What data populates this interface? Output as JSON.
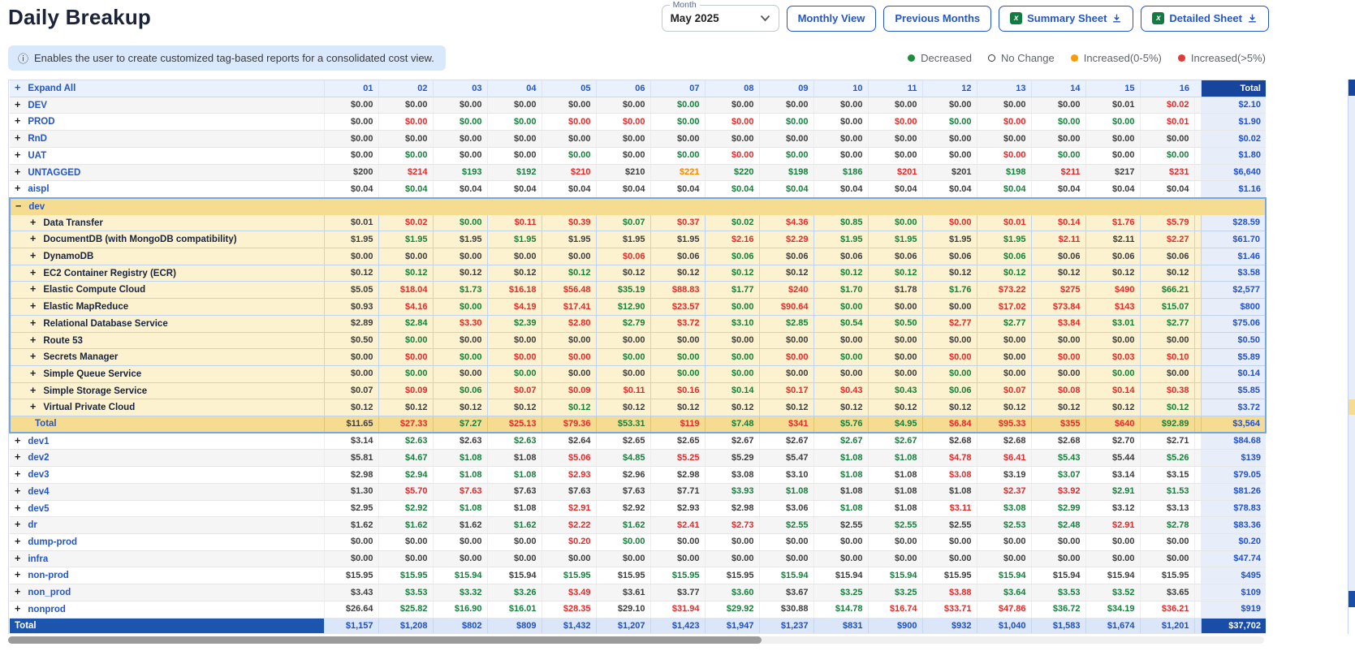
{
  "page": {
    "title": "Daily Breakup"
  },
  "toolbar": {
    "month_label": "Month",
    "month_value": "May 2025",
    "monthly_view": "Monthly View",
    "previous_months": "Previous Months",
    "summary_sheet": "Summary Sheet",
    "detailed_sheet": "Detailed Sheet",
    "excel_icon_color": "#107C41",
    "accent_color": "#2456c4"
  },
  "banner": {
    "text": "Enables the user to create customized tag-based reports for a consolidated cost view."
  },
  "legend": {
    "items": [
      {
        "label": "Decreased",
        "color": "#1e8e3e",
        "style": "filled"
      },
      {
        "label": "No Change",
        "color": "#333333",
        "style": "open"
      },
      {
        "label": "Increased(0-5%)",
        "color": "#f90",
        "style": "filled"
      },
      {
        "label": "Increased(>5%)",
        "color": "#e53935",
        "style": "filled"
      }
    ]
  },
  "table": {
    "expand_all": "Expand All",
    "total_header": "Total",
    "days": [
      "01",
      "02",
      "03",
      "04",
      "05",
      "06",
      "07",
      "08",
      "09",
      "10",
      "11",
      "12",
      "13",
      "14",
      "15",
      "16"
    ],
    "color_key": {
      "k": "no-change",
      "g": "decreased",
      "o": "increased-0-5",
      "r": "increased-gt5"
    },
    "rows": [
      {
        "label": "DEV",
        "type": "top",
        "shade": true,
        "expand": "plus",
        "values": [
          "$0.00",
          "$0.00",
          "$0.00",
          "$0.00",
          "$0.00",
          "$0.00",
          "$0.00",
          "$0.00",
          "$0.00",
          "$0.00",
          "$0.00",
          "$0.00",
          "$0.00",
          "$0.00",
          "$0.01",
          "$0.02"
        ],
        "colors": "kkkkkkgkkkkkkkkr",
        "total": "$2.10"
      },
      {
        "label": "PROD",
        "type": "top",
        "shade": false,
        "expand": "plus",
        "values": [
          "$0.00",
          "$0.00",
          "$0.00",
          "$0.00",
          "$0.00",
          "$0.00",
          "$0.00",
          "$0.00",
          "$0.00",
          "$0.00",
          "$0.00",
          "$0.00",
          "$0.00",
          "$0.00",
          "$0.00",
          "$0.01"
        ],
        "colors": "krggrrgrgkrgrggr",
        "total": "$1.90"
      },
      {
        "label": "RnD",
        "type": "top",
        "shade": true,
        "expand": "plus",
        "values": [
          "$0.00",
          "$0.00",
          "$0.00",
          "$0.00",
          "$0.00",
          "$0.00",
          "$0.00",
          "$0.00",
          "$0.00",
          "$0.00",
          "$0.00",
          "$0.00",
          "$0.00",
          "$0.00",
          "$0.00",
          "$0.00"
        ],
        "colors": "kkkkkkkkkkkkkkkk",
        "total": "$0.02"
      },
      {
        "label": "UAT",
        "type": "top",
        "shade": false,
        "expand": "plus",
        "values": [
          "$0.00",
          "$0.00",
          "$0.00",
          "$0.00",
          "$0.00",
          "$0.00",
          "$0.00",
          "$0.00",
          "$0.00",
          "$0.00",
          "$0.00",
          "$0.00",
          "$0.00",
          "$0.00",
          "$0.00",
          "$0.00"
        ],
        "colors": "kgkkgkgrgkkkrgkg",
        "total": "$1.80"
      },
      {
        "label": "UNTAGGED",
        "type": "top",
        "shade": true,
        "expand": "plus",
        "values": [
          "$200",
          "$214",
          "$193",
          "$192",
          "$210",
          "$210",
          "$221",
          "$220",
          "$198",
          "$186",
          "$201",
          "$201",
          "$198",
          "$211",
          "$217",
          "$231"
        ],
        "colors": "krggrkogggrkgrkr",
        "total": "$6,640"
      },
      {
        "label": "aispl",
        "type": "top",
        "shade": false,
        "expand": "plus",
        "values": [
          "$0.04",
          "$0.04",
          "$0.04",
          "$0.04",
          "$0.04",
          "$0.04",
          "$0.04",
          "$0.04",
          "$0.04",
          "$0.04",
          "$0.04",
          "$0.04",
          "$0.04",
          "$0.04",
          "$0.04",
          "$0.04"
        ],
        "colors": "kgkkkkkggkkkgkkk",
        "total": "$1.16"
      },
      {
        "label": "dev",
        "type": "sec-head",
        "expand": "minus",
        "values": [
          "",
          "",
          "",
          "",
          "",
          "",
          "",
          "",
          "",
          "",
          "",
          "",
          "",
          "",
          "",
          ""
        ],
        "colors": "kkkkkkkkkkkkkkkk",
        "total": ""
      },
      {
        "label": "Data Transfer",
        "type": "sub",
        "expand": "plus",
        "values": [
          "$0.01",
          "$0.02",
          "$0.00",
          "$0.11",
          "$0.39",
          "$0.07",
          "$0.37",
          "$0.02",
          "$4.36",
          "$0.85",
          "$0.00",
          "$0.00",
          "$0.01",
          "$0.14",
          "$1.76",
          "$5.79"
        ],
        "colors": "krgrrgrgrggrrrrr",
        "total": "$28.59"
      },
      {
        "label": "DocumentDB (with MongoDB compatibility)",
        "type": "sub",
        "expand": "plus",
        "values": [
          "$1.95",
          "$1.95",
          "$1.95",
          "$1.95",
          "$1.95",
          "$1.95",
          "$1.95",
          "$2.16",
          "$2.29",
          "$1.95",
          "$1.95",
          "$1.95",
          "$1.95",
          "$2.11",
          "$2.11",
          "$2.27"
        ],
        "colors": "kgkgkkkrrggkgrkr",
        "total": "$61.70"
      },
      {
        "label": "DynamoDB",
        "type": "sub",
        "expand": "plus",
        "values": [
          "$0.00",
          "$0.00",
          "$0.00",
          "$0.00",
          "$0.00",
          "$0.06",
          "$0.06",
          "$0.06",
          "$0.06",
          "$0.06",
          "$0.06",
          "$0.06",
          "$0.06",
          "$0.06",
          "$0.06",
          "$0.06"
        ],
        "colors": "kkkkkrkgkkkkgkkk",
        "total": "$1.46"
      },
      {
        "label": "EC2 Container Registry (ECR)",
        "type": "sub",
        "expand": "plus",
        "values": [
          "$0.12",
          "$0.12",
          "$0.12",
          "$0.12",
          "$0.12",
          "$0.12",
          "$0.12",
          "$0.12",
          "$0.12",
          "$0.12",
          "$0.12",
          "$0.12",
          "$0.12",
          "$0.12",
          "$0.12",
          "$0.12"
        ],
        "colors": "kgkkgkkgkggkgkkk",
        "total": "$3.58"
      },
      {
        "label": "Elastic Compute Cloud",
        "type": "sub",
        "expand": "plus",
        "values": [
          "$5.05",
          "$18.04",
          "$1.73",
          "$16.18",
          "$56.48",
          "$35.19",
          "$88.83",
          "$1.77",
          "$240",
          "$1.70",
          "$1.78",
          "$1.76",
          "$73.22",
          "$275",
          "$490",
          "$66.21"
        ],
        "colors": "krgrrgrgrgkgrrrg",
        "total": "$2,577"
      },
      {
        "label": "Elastic MapReduce",
        "type": "sub",
        "expand": "plus",
        "values": [
          "$0.93",
          "$4.16",
          "$0.00",
          "$4.19",
          "$17.41",
          "$12.90",
          "$23.57",
          "$0.00",
          "$90.64",
          "$0.00",
          "$0.00",
          "$0.00",
          "$17.02",
          "$73.84",
          "$143",
          "$15.07"
        ],
        "colors": "krgrrgrgrgkkrrrg",
        "total": "$800"
      },
      {
        "label": "Relational Database Service",
        "type": "sub",
        "expand": "plus",
        "values": [
          "$2.89",
          "$2.84",
          "$3.30",
          "$2.39",
          "$2.80",
          "$2.79",
          "$3.72",
          "$3.10",
          "$2.85",
          "$0.54",
          "$0.50",
          "$2.77",
          "$2.77",
          "$3.84",
          "$3.01",
          "$2.77"
        ],
        "colors": "kgrgrgrggggrgrgg",
        "total": "$75.06"
      },
      {
        "label": "Route 53",
        "type": "sub",
        "expand": "plus",
        "values": [
          "$0.50",
          "$0.00",
          "$0.00",
          "$0.00",
          "$0.00",
          "$0.00",
          "$0.00",
          "$0.00",
          "$0.00",
          "$0.00",
          "$0.00",
          "$0.00",
          "$0.00",
          "$0.00",
          "$0.00",
          "$0.00"
        ],
        "colors": "kgkkkkkkkkkkkkkk",
        "total": "$0.50"
      },
      {
        "label": "Secrets Manager",
        "type": "sub",
        "expand": "plus",
        "values": [
          "$0.00",
          "$0.00",
          "$0.00",
          "$0.00",
          "$0.00",
          "$0.00",
          "$0.00",
          "$0.00",
          "$0.00",
          "$0.00",
          "$0.00",
          "$0.00",
          "$0.00",
          "$0.00",
          "$0.03",
          "$0.10"
        ],
        "colors": "krgrrgggrgkrkrrr",
        "total": "$5.89"
      },
      {
        "label": "Simple Queue Service",
        "type": "sub",
        "expand": "plus",
        "values": [
          "$0.00",
          "$0.00",
          "$0.00",
          "$0.00",
          "$0.00",
          "$0.00",
          "$0.00",
          "$0.00",
          "$0.00",
          "$0.00",
          "$0.00",
          "$0.00",
          "$0.00",
          "$0.00",
          "$0.00",
          "$0.00"
        ],
        "colors": "kgkgkkggkkkgkkgk",
        "total": "$0.14"
      },
      {
        "label": "Simple Storage Service",
        "type": "sub",
        "expand": "plus",
        "values": [
          "$0.07",
          "$0.09",
          "$0.06",
          "$0.07",
          "$0.09",
          "$0.11",
          "$0.16",
          "$0.14",
          "$0.17",
          "$0.43",
          "$0.43",
          "$0.06",
          "$0.07",
          "$0.08",
          "$0.14",
          "$0.38"
        ],
        "colors": "krgrrrrgrrggrrrr",
        "total": "$5.85"
      },
      {
        "label": "Virtual Private Cloud",
        "type": "sub",
        "expand": "plus",
        "values": [
          "$0.12",
          "$0.12",
          "$0.12",
          "$0.12",
          "$0.12",
          "$0.12",
          "$0.12",
          "$0.12",
          "$0.12",
          "$0.12",
          "$0.12",
          "$0.12",
          "$0.12",
          "$0.12",
          "$0.12",
          "$0.12"
        ],
        "colors": "kkkkgkkkkkkkkkkg",
        "total": "$3.72"
      },
      {
        "label": "Total",
        "type": "sec-total",
        "values": [
          "$11.65",
          "$27.33",
          "$7.27",
          "$25.13",
          "$79.36",
          "$53.31",
          "$119",
          "$7.48",
          "$341",
          "$5.76",
          "$4.95",
          "$6.84",
          "$95.33",
          "$355",
          "$640",
          "$92.89"
        ],
        "colors": "krgrrgrgrggrrrrg",
        "total": "$3,564"
      },
      {
        "label": "dev1",
        "type": "top",
        "shade": false,
        "expand": "plus",
        "values": [
          "$3.14",
          "$2.63",
          "$2.63",
          "$2.63",
          "$2.64",
          "$2.65",
          "$2.65",
          "$2.67",
          "$2.67",
          "$2.67",
          "$2.67",
          "$2.68",
          "$2.68",
          "$2.68",
          "$2.70",
          "$2.71"
        ],
        "colors": "kgkgkkkkkggkkkkk",
        "total": "$84.68"
      },
      {
        "label": "dev2",
        "type": "top",
        "shade": true,
        "expand": "plus",
        "values": [
          "$5.81",
          "$4.67",
          "$1.08",
          "$1.08",
          "$5.06",
          "$4.85",
          "$5.25",
          "$5.29",
          "$5.47",
          "$1.08",
          "$1.08",
          "$4.78",
          "$6.41",
          "$5.43",
          "$5.44",
          "$5.26"
        ],
        "colors": "kggkrgrkkggrrgkg",
        "total": "$139"
      },
      {
        "label": "dev3",
        "type": "top",
        "shade": false,
        "expand": "plus",
        "values": [
          "$2.98",
          "$2.94",
          "$1.08",
          "$1.08",
          "$2.93",
          "$2.96",
          "$2.98",
          "$3.08",
          "$3.10",
          "$1.08",
          "$1.08",
          "$3.08",
          "$3.19",
          "$3.07",
          "$3.14",
          "$3.15"
        ],
        "colors": "kgggrkkkkgkrkgkk",
        "total": "$79.05"
      },
      {
        "label": "dev4",
        "type": "top",
        "shade": true,
        "expand": "plus",
        "values": [
          "$1.30",
          "$5.70",
          "$7.63",
          "$7.63",
          "$7.63",
          "$7.63",
          "$7.71",
          "$3.93",
          "$1.08",
          "$1.08",
          "$1.08",
          "$1.08",
          "$2.37",
          "$3.92",
          "$2.91",
          "$1.53"
        ],
        "colors": "krrkkkkggkkkrrgg",
        "total": "$81.26"
      },
      {
        "label": "dev5",
        "type": "top",
        "shade": false,
        "expand": "plus",
        "values": [
          "$2.95",
          "$2.92",
          "$1.08",
          "$1.08",
          "$2.91",
          "$2.92",
          "$2.93",
          "$2.98",
          "$3.06",
          "$1.08",
          "$1.08",
          "$3.11",
          "$3.08",
          "$2.99",
          "$3.12",
          "$3.13"
        ],
        "colors": "kggkrkkkkgkrggkk",
        "total": "$78.83"
      },
      {
        "label": "dr",
        "type": "top",
        "shade": true,
        "expand": "plus",
        "values": [
          "$1.62",
          "$1.62",
          "$1.62",
          "$1.62",
          "$2.22",
          "$1.62",
          "$2.41",
          "$2.73",
          "$2.55",
          "$2.55",
          "$2.55",
          "$2.55",
          "$2.53",
          "$2.48",
          "$2.91",
          "$2.78"
        ],
        "colors": "kgkgrgrrgkgkggrg",
        "total": "$83.36"
      },
      {
        "label": "dump-prod",
        "type": "top",
        "shade": false,
        "expand": "plus",
        "values": [
          "$0.00",
          "$0.00",
          "$0.00",
          "$0.00",
          "$0.20",
          "$0.00",
          "$0.00",
          "$0.00",
          "$0.00",
          "$0.00",
          "$0.00",
          "$0.00",
          "$0.00",
          "$0.00",
          "$0.00",
          "$0.00"
        ],
        "colors": "kkkkrgkkkkkkkkkk",
        "total": "$0.20"
      },
      {
        "label": "infra",
        "type": "top",
        "shade": true,
        "expand": "plus",
        "values": [
          "$0.00",
          "$0.00",
          "$0.00",
          "$0.00",
          "$0.00",
          "$0.00",
          "$0.00",
          "$0.00",
          "$0.00",
          "$0.00",
          "$0.00",
          "$0.00",
          "$0.00",
          "$0.00",
          "$0.00",
          "$0.00"
        ],
        "colors": "kkkkkkkkkkkkkkkk",
        "total": "$47.74"
      },
      {
        "label": "non-prod",
        "type": "top",
        "shade": false,
        "expand": "plus",
        "values": [
          "$15.95",
          "$15.95",
          "$15.94",
          "$15.94",
          "$15.95",
          "$15.95",
          "$15.95",
          "$15.95",
          "$15.94",
          "$15.94",
          "$15.94",
          "$15.95",
          "$15.94",
          "$15.94",
          "$15.94",
          "$15.95"
        ],
        "colors": "kggkgkgkgkgkgkkk",
        "total": "$495"
      },
      {
        "label": "non_prod",
        "type": "top",
        "shade": true,
        "expand": "plus",
        "values": [
          "$3.43",
          "$3.53",
          "$3.32",
          "$3.26",
          "$3.49",
          "$3.61",
          "$3.77",
          "$3.60",
          "$3.67",
          "$3.25",
          "$3.25",
          "$3.88",
          "$3.64",
          "$3.53",
          "$3.52",
          "$3.65"
        ],
        "colors": "kgggrkkgkggrgggk",
        "total": "$109"
      },
      {
        "label": "nonprod",
        "type": "top",
        "shade": false,
        "expand": "plus",
        "values": [
          "$26.64",
          "$25.82",
          "$16.90",
          "$16.01",
          "$28.35",
          "$29.10",
          "$31.94",
          "$29.92",
          "$30.88",
          "$14.78",
          "$16.74",
          "$33.71",
          "$47.86",
          "$36.72",
          "$34.19",
          "$36.21"
        ],
        "colors": "kgggrkrgkgrrrggr",
        "total": "$919"
      }
    ],
    "grand_total": {
      "label": "Total",
      "values": [
        "$1,157",
        "$1,208",
        "$802",
        "$809",
        "$1,432",
        "$1,207",
        "$1,423",
        "$1,947",
        "$1,237",
        "$831",
        "$900",
        "$932",
        "$1,040",
        "$1,583",
        "$1,674",
        "$1,201"
      ],
      "total": "$37,702"
    }
  }
}
